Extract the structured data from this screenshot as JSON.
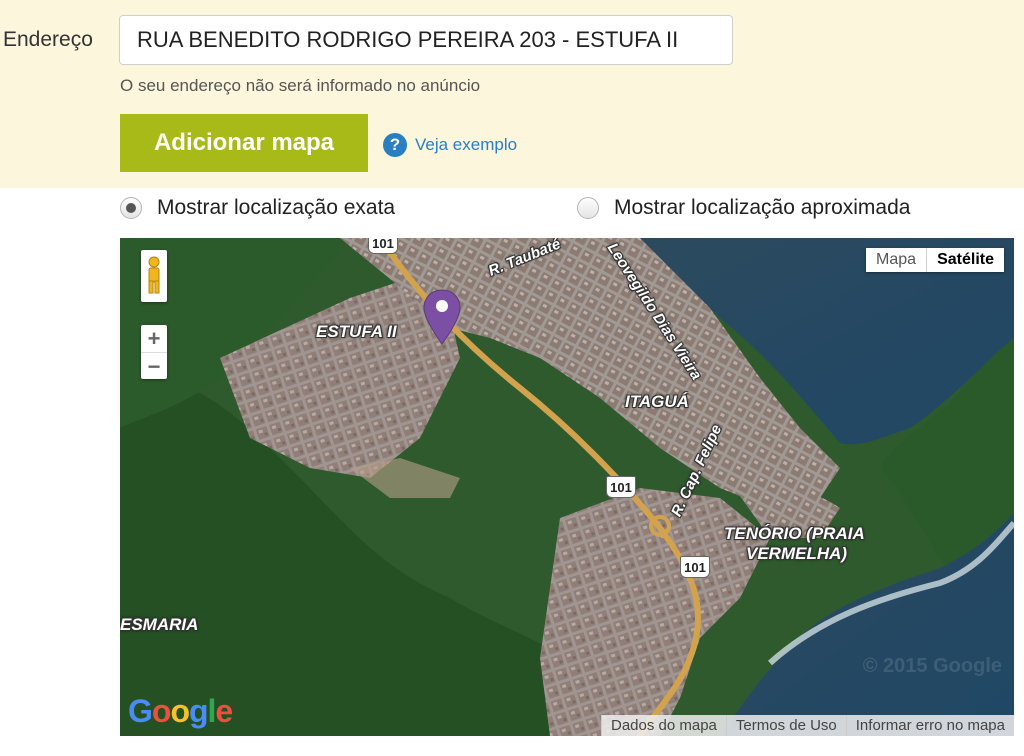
{
  "address": {
    "label": "Endereço",
    "value": "RUA BENEDITO RODRIGO PEREIRA 203 - ESTUFA II",
    "hint": "O seu endereço não será informado no anúncio"
  },
  "actions": {
    "add_map_label": "Adicionar mapa",
    "help_icon_char": "?",
    "see_example_label": "Veja exemplo"
  },
  "location_options": [
    {
      "label": "Mostrar localização exata",
      "selected": true
    },
    {
      "label": "Mostrar localização aproximada",
      "selected": false
    }
  ],
  "map": {
    "type_buttons": [
      "Mapa",
      "Satélite"
    ],
    "active_type": "Satélite",
    "zoom_in": "+",
    "zoom_out": "−",
    "labels": {
      "estufa": "ESTUFA II",
      "itagua": "ITAGUÁ",
      "tenorio_1": "TENÓRIO (PRAIA",
      "tenorio_2": "VERMELHA)",
      "esmaria": "ESMARIA",
      "r_taubate": "R. Taubaté",
      "leovegildo": "Leovegildo Dias Vieira",
      "cap_felipe": "R. Cap. Felipe"
    },
    "road_shields": [
      "101",
      "101",
      "101"
    ],
    "watermark": "© 2015 Google",
    "logo": "Google",
    "footer": [
      "Dados do mapa",
      "Termos de Uso",
      "Informar erro no mapa"
    ],
    "colors": {
      "pin": "#7b4fa3",
      "button": "#a8ba18",
      "link": "#2a7fc4"
    }
  }
}
